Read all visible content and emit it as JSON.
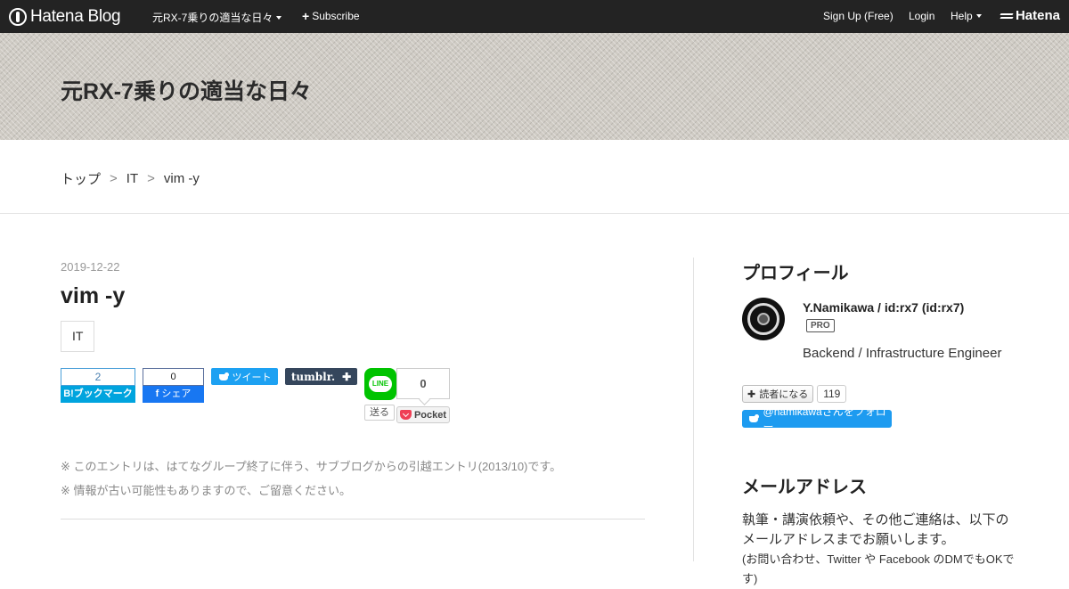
{
  "globalbar": {
    "brand": "Hatena Blog",
    "blog_menu": "元RX-7乗りの適当な日々",
    "subscribe": "Subscribe",
    "signup": "Sign Up (Free)",
    "login": "Login",
    "help": "Help",
    "hatena": "Hatena"
  },
  "header": {
    "blog_title": "元RX-7乗りの適当な日々"
  },
  "breadcrumb": {
    "top": "トップ",
    "category": "IT",
    "current": "vim -y",
    "separator": ">"
  },
  "entry": {
    "date": "2019-12-22",
    "title": "vim -y",
    "category": "IT",
    "notes": [
      "※ このエントリは、はてなグループ終了に伴う、サブブログからの引越エントリ(2013/10)です。",
      "※ 情報が古い可能性もありますので、ご留意ください。"
    ]
  },
  "share": {
    "hatena_count": "2",
    "hatena_label": "B!ブックマーク",
    "facebook_count": "0",
    "facebook_label": "シェア",
    "twitter_label": "ツイート",
    "tumblr_label": "tumblr.",
    "line_icon_text": "LINE",
    "line_label": "送る",
    "pocket_count": "0",
    "pocket_label": "Pocket"
  },
  "sidebar": {
    "profile_heading": "プロフィール",
    "profile_name": "Y.Namikawa / id:rx7 (id:rx7)",
    "pro_badge": "PRO",
    "profile_desc": "Backend / Infrastructure Engineer",
    "subscribe_label": "読者になる",
    "subscribe_count": "119",
    "follow_label": "@namikawaさんをフォロー",
    "mail_heading": "メールアドレス",
    "mail_text": "執筆・講演依頼や、その他ご連絡は、以下のメールアドレスまでお願いします。",
    "mail_text_cut": "(お問い合わせ、Twitter や Facebook のDMでもOKです)"
  },
  "colors": {
    "globalbar": "#232323",
    "hatena_blue": "#00a4de",
    "twitter": "#1da1f2",
    "line": "#00c300",
    "pocket": "#ef4056"
  }
}
